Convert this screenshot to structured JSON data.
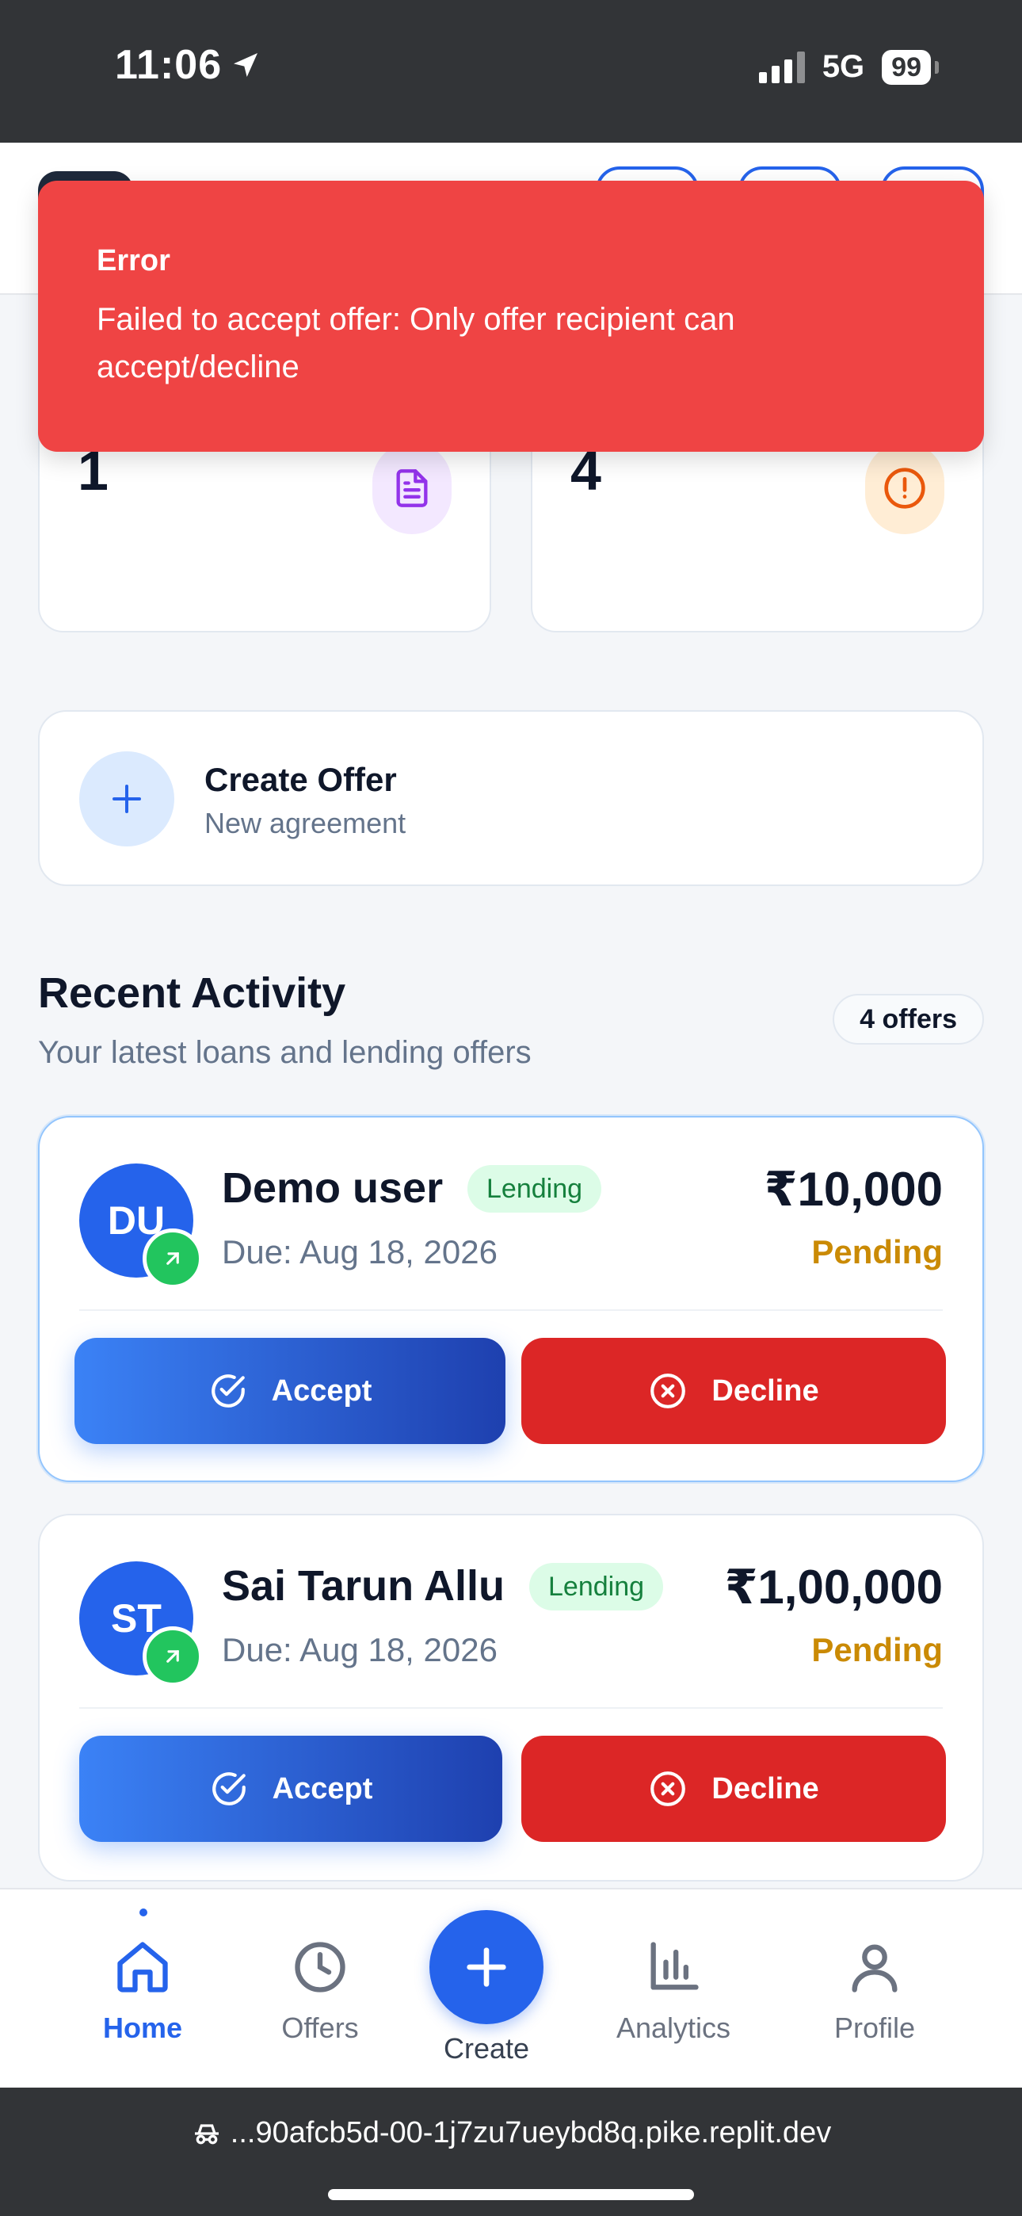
{
  "status_bar": {
    "time": "11:06",
    "network": "5G",
    "battery": "99"
  },
  "toast": {
    "title": "Error",
    "message": "Failed to accept offer: Only offer recipient can accept/decline",
    "color": "#ef4444"
  },
  "stats": [
    {
      "value": "1",
      "icon": "document-icon",
      "icon_color": "#9333ea",
      "icon_bg": "#f3e8ff"
    },
    {
      "value": "4",
      "icon": "alert-circle-icon",
      "icon_color": "#ea580c",
      "icon_bg": "#ffedd5"
    }
  ],
  "create_offer": {
    "title": "Create Offer",
    "subtitle": "New agreement",
    "icon": "plus-icon"
  },
  "recent_activity": {
    "title": "Recent Activity",
    "subtitle": "Your latest loans and lending offers",
    "count_badge": "4 offers"
  },
  "offers": [
    {
      "initials": "DU",
      "name": "Demo user",
      "type": "Lending",
      "due": "Due: Aug 18, 2026",
      "amount": "₹10,000",
      "status": "Pending",
      "accept_label": "Accept",
      "decline_label": "Decline"
    },
    {
      "initials": "ST",
      "name": "Sai Tarun Allu",
      "type": "Lending",
      "due": "Due: Aug 18, 2026",
      "amount": "₹1,00,000",
      "status": "Pending",
      "accept_label": "Accept",
      "decline_label": "Decline"
    }
  ],
  "nav": {
    "items": [
      {
        "label": "Home",
        "icon": "home-icon",
        "active": true
      },
      {
        "label": "Offers",
        "icon": "clock-icon",
        "active": false
      },
      {
        "label": "Create",
        "icon": "plus-icon",
        "active": false
      },
      {
        "label": "Analytics",
        "icon": "bar-chart-icon",
        "active": false
      },
      {
        "label": "Profile",
        "icon": "user-icon",
        "active": false
      }
    ]
  },
  "browser": {
    "url": "...90afcb5d-00-1j7zu7ueybd8q.pike.replit.dev"
  },
  "colors": {
    "primary": "#2563eb",
    "danger": "#dc2626",
    "pending": "#ca8a04",
    "success": "#22c55e"
  }
}
